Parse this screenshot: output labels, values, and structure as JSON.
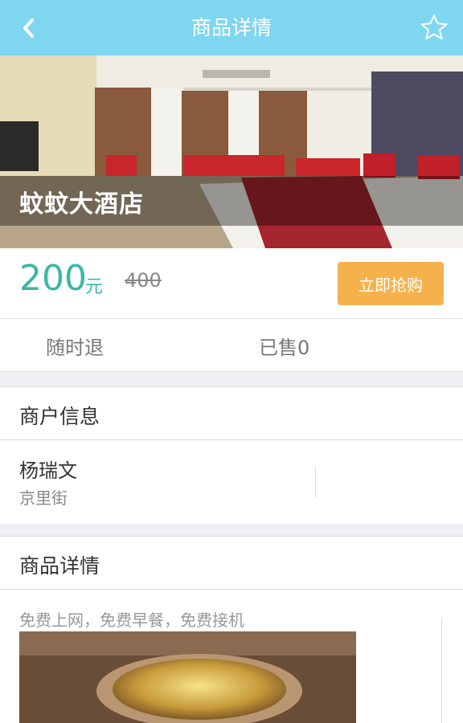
{
  "header": {
    "title": "商品详情",
    "back_icon": "chevron-left-icon",
    "favorite_icon": "star-outline-icon",
    "color": "#7fd6f0"
  },
  "hero": {
    "hotel_name": "蚊蚊大酒店"
  },
  "pricing": {
    "price": "200",
    "unit": "元",
    "original_price": "400",
    "buy_label": "立即抢购",
    "price_color": "#3bb7a6",
    "button_color": "#f5b24c"
  },
  "tags": {
    "refund": "随时退",
    "sold": "已售0"
  },
  "merchant": {
    "section_title": "商户信息",
    "name": "杨瑞文",
    "address": "京里街"
  },
  "product": {
    "section_title": "商品详情",
    "description": "免费上网，免费早餐，免费接机"
  }
}
